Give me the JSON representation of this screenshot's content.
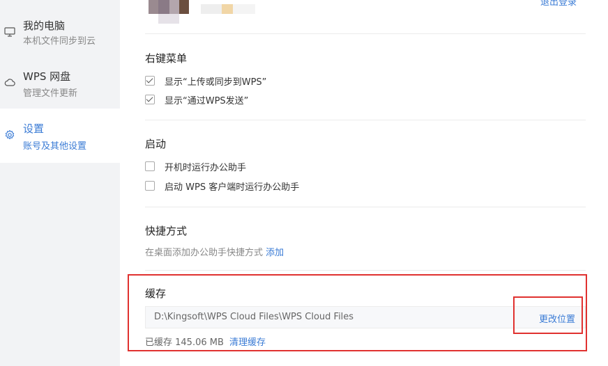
{
  "sidebar": {
    "items": [
      {
        "title": "我的电脑",
        "subtitle": "本机文件同步到云",
        "icon": "monitor-icon"
      },
      {
        "title": "WPS 网盘",
        "subtitle": "管理文件更新",
        "icon": "cloud-icon"
      },
      {
        "title": "设置",
        "subtitle": "账号及其他设置",
        "icon": "gear-icon"
      }
    ],
    "active_index": 2
  },
  "account": {
    "logout_label": "退出登录"
  },
  "sections": {
    "context_menu": {
      "title": "右键菜单",
      "options": [
        {
          "label": "显示“上传或同步到WPS”",
          "checked": true
        },
        {
          "label": "显示“通过WPS发送”",
          "checked": true
        }
      ]
    },
    "startup": {
      "title": "启动",
      "options": [
        {
          "label": "开机时运行办公助手",
          "checked": false
        },
        {
          "label": "启动 WPS 客户端时运行办公助手",
          "checked": false
        }
      ]
    },
    "shortcut": {
      "title": "快捷方式",
      "hint": "在桌面添加办公助手快捷方式",
      "add_label": "添加"
    },
    "cache": {
      "title": "缓存",
      "path": "D:\\Kingsoft\\WPS Cloud Files\\WPS Cloud Files",
      "change_label": "更改位置",
      "size_text": "已缓存 145.06 MB",
      "clear_label": "清理缓存"
    }
  },
  "colors": {
    "accent": "#3a7bd5",
    "highlight": "#e0312f",
    "sidebar_bg": "#f2f3f5"
  }
}
